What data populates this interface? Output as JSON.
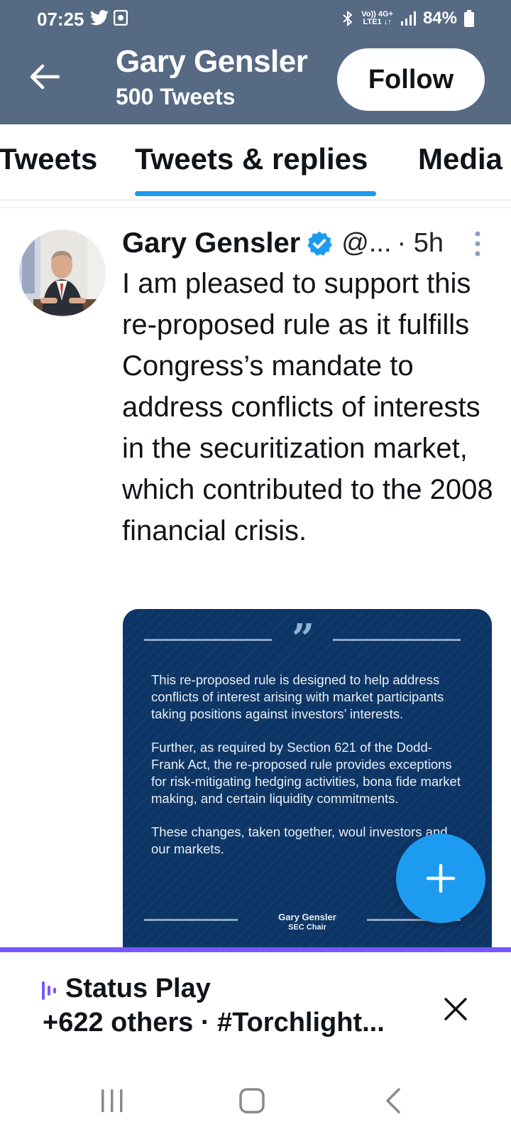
{
  "status_bar": {
    "time": "07:25",
    "net_top": "Vo)) 4G+",
    "net_bottom": "LTE1 ↓↑",
    "battery": "84%"
  },
  "header": {
    "title": "Gary Gensler",
    "subtitle": "500 Tweets",
    "follow_label": "Follow"
  },
  "tabs": [
    {
      "label": "Tweets"
    },
    {
      "label": "Tweets & replies"
    },
    {
      "label": "Media"
    }
  ],
  "tweet": {
    "name": "Gary Gensler",
    "handle": "@...",
    "time": "· 5h",
    "text": "I am pleased to support this re-proposed rule as it fulfills Congress’s mandate to address conflicts of interests in the securitization market, which contributed to the 2008 financial crisis."
  },
  "quote_image": {
    "paragraph_1": "This re-proposed rule is designed to help address conflicts of interest arising with market participants taking positions against investors’ interests.",
    "paragraph_2": "Further, as required by Section 621 of the Dodd-Frank Act, the re-proposed rule provides exceptions for risk-mitigating hedging activities, bona fide market making, and certain liquidity commitments.",
    "paragraph_3": "These changes, taken together, woul investors and our markets.",
    "author": "Gary Gensler",
    "role": "SEC Chair"
  },
  "spaces_bar": {
    "title": "Status Play",
    "subtitle": "+622 others · #Torchlight..."
  },
  "colors": {
    "header_bg": "#566a84",
    "accent": "#1d9bf0",
    "spaces_accent": "#7856ff",
    "quote_bg": "#0c3565"
  }
}
